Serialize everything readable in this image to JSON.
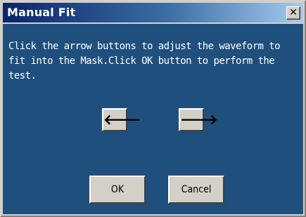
{
  "window": {
    "title": "Manual Fit",
    "close_glyph": "✕"
  },
  "message": "Click the arrow buttons to adjust the waveform to fit into the Mask.Click OK button to perform the test.",
  "buttons": {
    "left_arrow": "🡐",
    "right_arrow": "🡒",
    "ok": "OK",
    "cancel": "Cancel"
  },
  "colors": {
    "client_background": "#1f4f7c",
    "titlebar_start": "#0a246a",
    "titlebar_end": "#a6caf0"
  }
}
